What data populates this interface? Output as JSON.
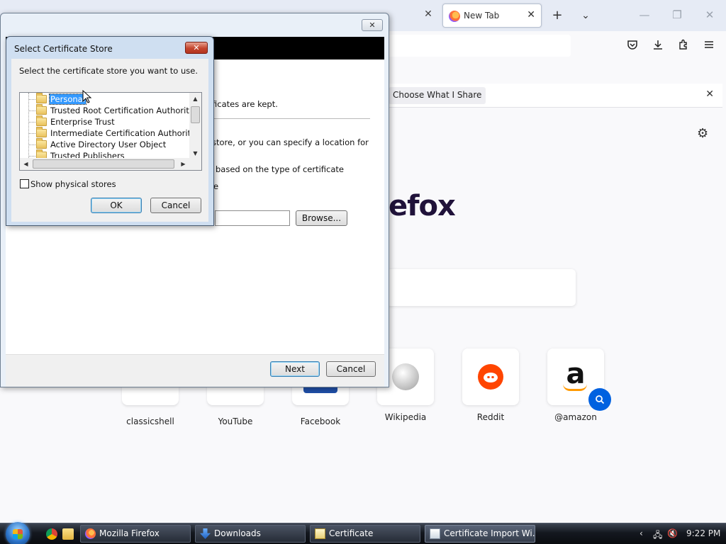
{
  "firefox": {
    "active_tab_title": "New Tab",
    "brand_partial": "efox",
    "notification_button": "Choose What I Share",
    "top_sites": [
      {
        "label": "classicshell"
      },
      {
        "label": "YouTube"
      },
      {
        "label": "Facebook"
      },
      {
        "label": "Wikipedia"
      },
      {
        "label": "Reddit"
      },
      {
        "label": "@amazon"
      }
    ]
  },
  "wizard": {
    "text_kept": "ficates are kept.",
    "text_store": "store, or you can specify a location for",
    "text_based": "based on the type of certificate",
    "text_e": "e",
    "browse_label": "Browse...",
    "next_label": "Next",
    "cancel_label": "Cancel"
  },
  "dialog": {
    "title": "Select Certificate Store",
    "prompt": "Select the certificate store you want to use.",
    "stores": [
      "Personal",
      "Trusted Root Certification Authorities",
      "Enterprise Trust",
      "Intermediate Certification Authorities",
      "Active Directory User Object",
      "Trusted Publishers"
    ],
    "selected_store": "Personal",
    "show_physical_label": "Show physical stores",
    "show_physical_checked": false,
    "ok_label": "OK",
    "cancel_label": "Cancel"
  },
  "taskbar": {
    "items": [
      {
        "label": "Mozilla Firefox"
      },
      {
        "label": "Downloads"
      },
      {
        "label": "Certificate"
      },
      {
        "label": "Certificate Import Wi..."
      }
    ],
    "clock": "9:22 PM"
  }
}
